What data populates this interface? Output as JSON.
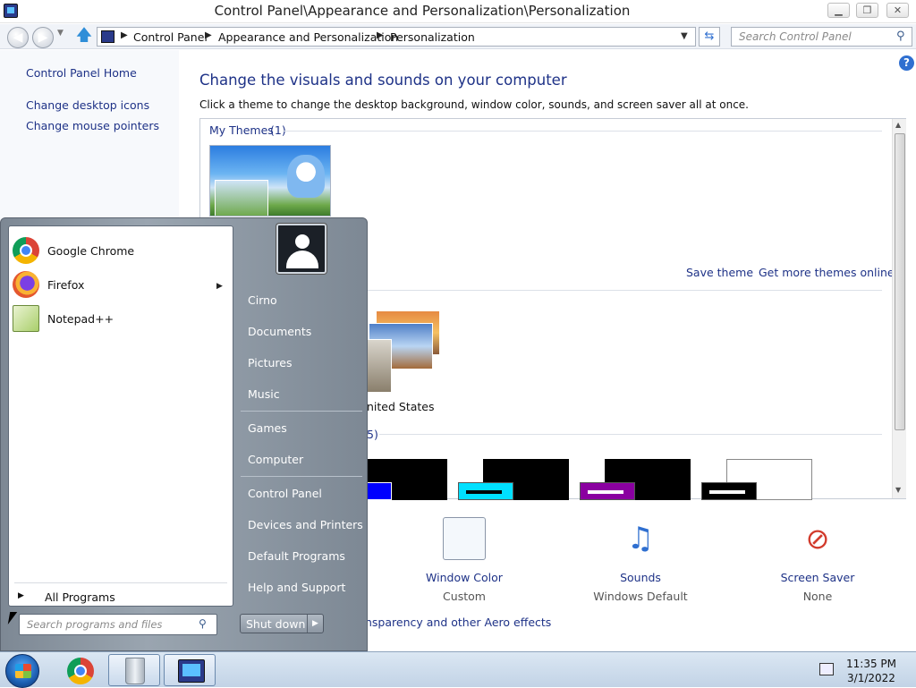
{
  "window": {
    "title": "Control Panel\\Appearance and Personalization\\Personalization",
    "minimize_glyph": "▁",
    "maximize_glyph": "❐",
    "close_glyph": "✕"
  },
  "address": {
    "crumbs": [
      "Control Panel",
      "Appearance and Personalization",
      "Personalization"
    ],
    "search_placeholder": "Search Control Panel"
  },
  "leftnav": {
    "home": "Control Panel Home",
    "links": [
      "Change desktop icons",
      "Change mouse pointers"
    ]
  },
  "main": {
    "heading": "Change the visuals and sounds on your computer",
    "description": "Click a theme to change the desktop background, window color, sounds, and screen saver all at once.",
    "my_themes_label": "My Themes",
    "my_themes_count": "(1)",
    "save_theme": "Save theme",
    "get_more_themes": "Get more themes online",
    "installed_theme_partial": "nited States",
    "basic_themes_count_partial": "5)",
    "basic_swatch_colors": [
      "#0000ff",
      "#00e0ff",
      "#8a00a0",
      "#000000"
    ],
    "bottom_items": [
      {
        "label": "Window Color",
        "sub": "Custom",
        "icon": "window-color-icon"
      },
      {
        "label": "Sounds",
        "sub": "Windows Default",
        "icon": "sounds-icon"
      },
      {
        "label": "Screen Saver",
        "sub": "None",
        "icon": "screen-saver-icon"
      }
    ],
    "aero_link_partial": "nsparency and other Aero effects"
  },
  "start_menu": {
    "programs": [
      {
        "name": "Google Chrome",
        "icon": "chrome-icon"
      },
      {
        "name": "Firefox",
        "icon": "firefox-icon"
      },
      {
        "name": "Notepad++",
        "icon": "notepadpp-icon"
      }
    ],
    "all_programs": "All Programs",
    "search_placeholder": "Search programs and files",
    "right_items": [
      "Cirno",
      "Documents",
      "Pictures",
      "Music",
      "Games",
      "Computer",
      "Control Panel",
      "Devices and Printers",
      "Default Programs",
      "Help and Support"
    ],
    "shutdown": "Shut down"
  },
  "taskbar": {
    "time": "11:35 PM",
    "date": "3/1/2022"
  }
}
